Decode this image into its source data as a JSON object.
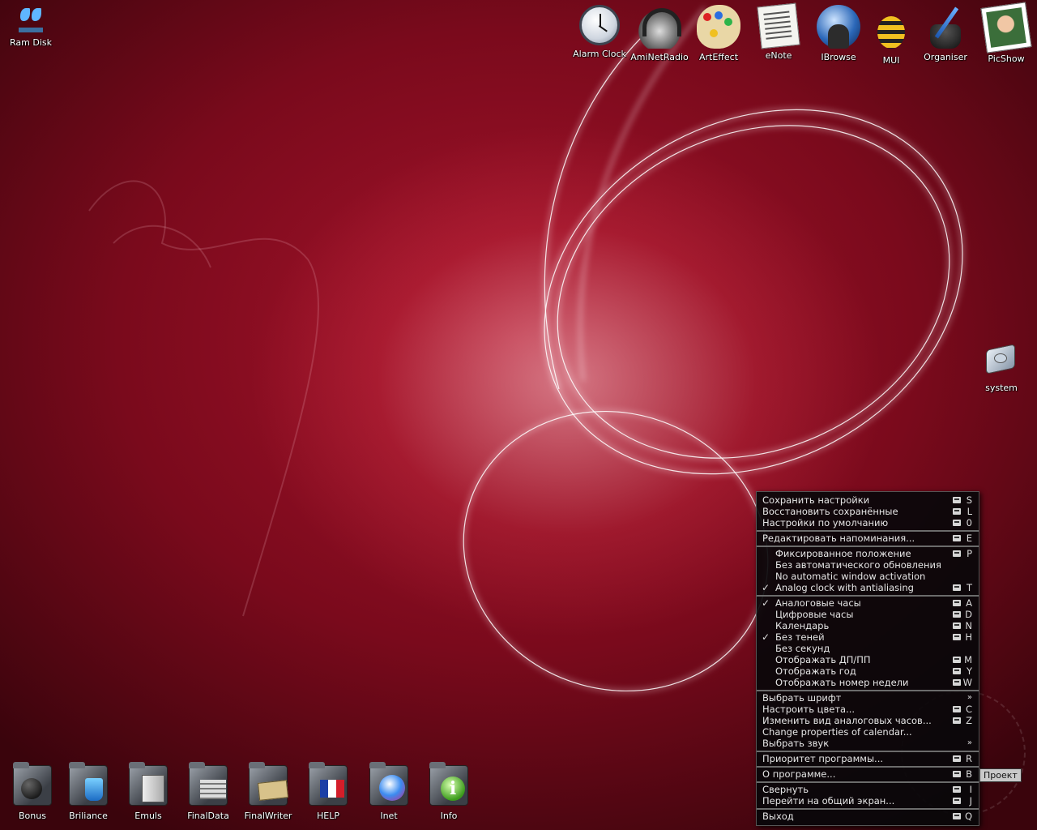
{
  "desktop": {
    "colors": {
      "bg_main": "#a8142c",
      "bg_dark": "#3a040c",
      "menu_bg": "#08080a"
    },
    "topleft_icon": {
      "label": "Ram Disk",
      "icon": "ram-disk-icon"
    },
    "top_icons": [
      {
        "label": "Alarm Clock",
        "icon": "alarm-clock-icon"
      },
      {
        "label": "AmiNetRadio",
        "icon": "headphones-icon"
      },
      {
        "label": "ArtEffect",
        "icon": "palette-icon"
      },
      {
        "label": "eNote",
        "icon": "notepad-icon"
      },
      {
        "label": "IBrowse",
        "icon": "globe-icon"
      },
      {
        "label": "MUI",
        "icon": "bee-icon"
      },
      {
        "label": "Organiser",
        "icon": "ink-pen-icon"
      },
      {
        "label": "PicShow",
        "icon": "photo-icon"
      }
    ],
    "system_icon": {
      "label": "system",
      "icon": "hard-disk-icon"
    },
    "drawers": [
      {
        "label": "Bonus",
        "icon": "bomb-drawer-icon"
      },
      {
        "label": "Briliance",
        "icon": "paint-drawer-icon"
      },
      {
        "label": "Emuls",
        "icon": "console-drawer-icon"
      },
      {
        "label": "FinalData",
        "icon": "books-drawer-icon"
      },
      {
        "label": "FinalWriter",
        "icon": "papers-drawer-icon"
      },
      {
        "label": "HELP",
        "icon": "flag-drawer-icon"
      },
      {
        "label": "Inet",
        "icon": "globe-drawer-icon"
      },
      {
        "label": "Info",
        "icon": "info-drawer-icon"
      }
    ]
  },
  "menu": {
    "groups": [
      [
        {
          "label": "Сохранить настройки",
          "key": "S"
        },
        {
          "label": "Восстановить сохранённые",
          "key": "L"
        },
        {
          "label": "Настройки по умолчанию",
          "key": "0"
        }
      ],
      [
        {
          "label": "Редактировать напоминания...",
          "key": "E"
        }
      ],
      [
        {
          "label": "Фиксированное положение",
          "key": "P",
          "indent": true
        },
        {
          "label": "Без автоматического обновления",
          "indent": true
        },
        {
          "label": "No automatic window activation",
          "indent": true
        },
        {
          "label": "Analog clock with antialiasing",
          "key": "T",
          "indent": true,
          "checked": true
        }
      ],
      [
        {
          "label": "Аналоговые часы",
          "key": "A",
          "indent": true,
          "checked": true
        },
        {
          "label": "Цифровые часы",
          "key": "D",
          "indent": true
        },
        {
          "label": "Календарь",
          "key": "N",
          "indent": true
        },
        {
          "label": "Без теней",
          "key": "H",
          "indent": true,
          "checked": true
        },
        {
          "label": "Без секунд",
          "indent": true
        },
        {
          "label": "Отображать ДП/ПП",
          "key": "M",
          "indent": true
        },
        {
          "label": "Отображать год",
          "key": "Y",
          "indent": true
        },
        {
          "label": "Отображать номер недели",
          "key": "W",
          "indent": true
        }
      ],
      [
        {
          "label": "Выбрать шрифт",
          "submenu": "»"
        },
        {
          "label": "Настроить цвета...",
          "key": "C"
        },
        {
          "label": "Изменить вид аналоговых часов...",
          "key": "Z"
        },
        {
          "label": "Change properties of calendar..."
        },
        {
          "label": "Выбрать звук",
          "submenu": "»"
        }
      ],
      [
        {
          "label": "Приоритет программы...",
          "key": "R"
        }
      ],
      [
        {
          "label": "О программе...",
          "key": "B"
        }
      ],
      [
        {
          "label": "Свернуть",
          "key": "I"
        },
        {
          "label": "Перейти на общий экран...",
          "key": "J"
        }
      ],
      [
        {
          "label": "Выход",
          "key": "Q"
        }
      ]
    ],
    "check_glyph": "✓"
  },
  "tooltip": {
    "text": "Проект"
  }
}
